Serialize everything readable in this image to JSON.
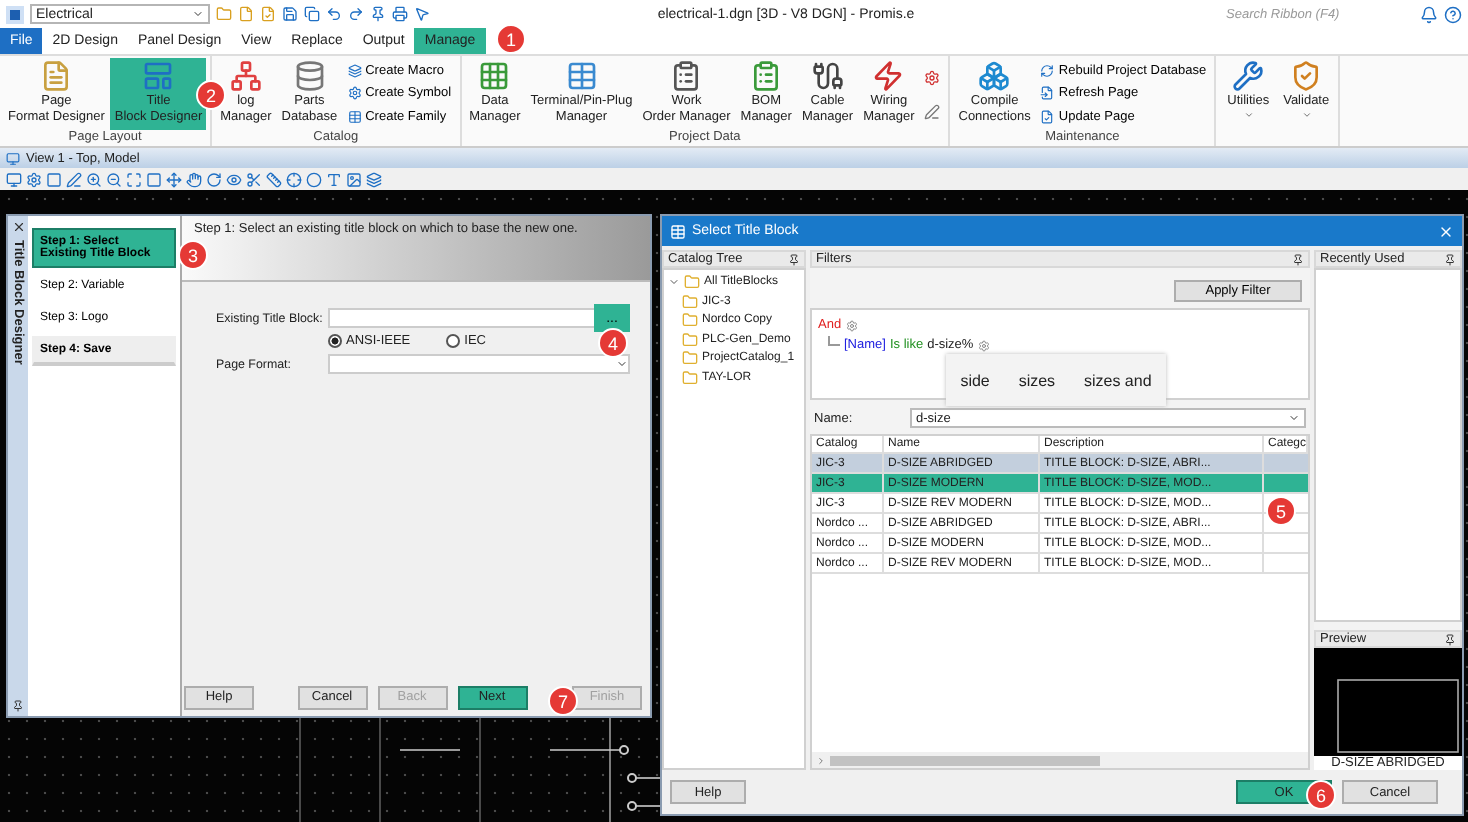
{
  "app": {
    "workspace": "Electrical",
    "document": "electrical-1.dgn [3D - V8 DGN] - Promis.e",
    "search_placeholder": "Search Ribbon (F4)"
  },
  "ribbon_tabs": [
    {
      "label": "File",
      "kind": "file",
      "selected": false
    },
    {
      "label": "2D Design",
      "kind": "tab",
      "selected": false
    },
    {
      "label": "Panel Design",
      "kind": "tab",
      "selected": false
    },
    {
      "label": "View",
      "kind": "tab",
      "selected": false
    },
    {
      "label": "Replace",
      "kind": "tab",
      "selected": false
    },
    {
      "label": "Output",
      "kind": "tab",
      "selected": false
    },
    {
      "label": "Manage",
      "kind": "tab",
      "selected": true
    }
  ],
  "ribbon_groups": [
    {
      "label": "Page Layout",
      "items": [
        {
          "kind": "large",
          "lines": [
            "Page",
            "Format Designer"
          ],
          "highlighted": false
        },
        {
          "kind": "large",
          "lines": [
            "Title",
            "Block Designer"
          ],
          "highlighted": true
        }
      ]
    },
    {
      "label": "Catalog",
      "items": [
        {
          "kind": "large",
          "lines": [
            "log",
            "Manager"
          ],
          "highlighted": false
        },
        {
          "kind": "large",
          "lines": [
            "Parts",
            "Database"
          ],
          "highlighted": false
        },
        {
          "kind": "small",
          "labels": [
            "Create Macro",
            "Create Symbol",
            "Create Family"
          ]
        }
      ]
    },
    {
      "label": "Project Data",
      "items": [
        {
          "kind": "large",
          "lines": [
            "Data",
            "Manager"
          ],
          "highlighted": false
        },
        {
          "kind": "large",
          "lines": [
            "Terminal/Pin-Plug",
            "Manager"
          ],
          "highlighted": false
        },
        {
          "kind": "large",
          "lines": [
            "Work",
            "Order Manager"
          ],
          "highlighted": false
        },
        {
          "kind": "large",
          "lines": [
            "BOM",
            "Manager"
          ],
          "highlighted": false
        },
        {
          "kind": "large",
          "lines": [
            "Cable",
            "Manager"
          ],
          "highlighted": false
        },
        {
          "kind": "large",
          "lines": [
            "Wiring",
            "Manager"
          ],
          "highlighted": false
        },
        {
          "kind": "icons"
        }
      ]
    },
    {
      "label": "Maintenance",
      "items": [
        {
          "kind": "large",
          "lines": [
            "Compile",
            "Connections"
          ],
          "highlighted": false
        },
        {
          "kind": "small",
          "labels": [
            "Rebuild Project Database",
            "Refresh Page",
            "Update Page"
          ]
        }
      ]
    },
    {
      "items": [
        {
          "kind": "menu",
          "lines": [
            "Utilities"
          ]
        },
        {
          "kind": "menu",
          "lines": [
            "Validate"
          ]
        }
      ]
    }
  ],
  "view": {
    "title": "View 1 - Top, Model"
  },
  "designer": {
    "side_title": "Title Block Designer",
    "steps": [
      {
        "label": "Step 1: Select Existing Title Block",
        "selected": true,
        "bold": true
      },
      {
        "label": "Step 2: Variable",
        "selected": false,
        "bold": false
      },
      {
        "label": "Step 3: Logo",
        "selected": false,
        "bold": false
      },
      {
        "label": "Step 4: Save",
        "selected": false,
        "bold": true
      }
    ],
    "instruction": "Step 1: Select an existing title block on which to base the new one.",
    "title_block_label": "Existing Title Block:",
    "browse_label": "...",
    "standards": [
      {
        "label": "ANSI-IEEE",
        "selected": true
      },
      {
        "label": "IEC",
        "selected": false
      }
    ],
    "page_format_label": "Page Format:",
    "buttons": [
      {
        "label": "Help",
        "disabled": false,
        "highlighted": false
      },
      {
        "label": "Cancel",
        "disabled": false,
        "highlighted": false
      },
      {
        "label": "Back",
        "disabled": true,
        "highlighted": false
      },
      {
        "label": "Next",
        "disabled": false,
        "highlighted": true
      },
      {
        "label": "Finish",
        "disabled": true,
        "highlighted": false
      }
    ]
  },
  "select_dialog": {
    "title": "Select Title Block",
    "catalog_tree": {
      "title": "Catalog Tree",
      "items": [
        {
          "label": "All TitleBlocks",
          "expanded": true,
          "children": [
            {
              "label": "JIC-3"
            },
            {
              "label": "Nordco Copy"
            },
            {
              "label": "PLC-Gen_Demo"
            },
            {
              "label": "ProjectCatalog_1"
            },
            {
              "label": "TAY-LOR"
            }
          ]
        }
      ]
    },
    "filters": {
      "title": "Filters",
      "apply_label": "Apply Filter",
      "operator": "And",
      "field": "[Name]",
      "condition": "Is like",
      "value": "d-size%",
      "suggestions": [
        "side",
        "sizes",
        "sizes and"
      ]
    },
    "name_filter": {
      "label": "Name:",
      "value": "d-size"
    },
    "table": {
      "columns": [
        "Catalog",
        "Name",
        "Description",
        "Categc"
      ],
      "rows": [
        {
          "cells": [
            "JIC-3",
            "D-SIZE ABRIDGED",
            "TITLE BLOCK: D-SIZE, ABRI..."
          ],
          "selected": false,
          "hovered": true
        },
        {
          "cells": [
            "JIC-3",
            "D-SIZE MODERN",
            "TITLE BLOCK: D-SIZE, MOD..."
          ],
          "selected": true,
          "hovered": false
        },
        {
          "cells": [
            "JIC-3",
            "D-SIZE REV MODERN",
            "TITLE BLOCK: D-SIZE, MOD..."
          ],
          "selected": false,
          "hovered": false
        },
        {
          "cells": [
            "Nordco ...",
            "D-SIZE ABRIDGED",
            "TITLE BLOCK: D-SIZE, ABRI..."
          ],
          "selected": false,
          "hovered": false
        },
        {
          "cells": [
            "Nordco ...",
            "D-SIZE MODERN",
            "TITLE BLOCK: D-SIZE, MOD..."
          ],
          "selected": false,
          "hovered": false
        },
        {
          "cells": [
            "Nordco ...",
            "D-SIZE REV MODERN",
            "TITLE BLOCK: D-SIZE, MOD..."
          ],
          "selected": false,
          "hovered": false
        }
      ]
    },
    "recently_used_title": "Recently Used",
    "preview": {
      "title": "Preview",
      "caption": "D-SIZE ABRIDGED"
    },
    "buttons": [
      {
        "label": "Help",
        "highlighted": false
      },
      {
        "label": "OK",
        "highlighted": true
      },
      {
        "label": "Cancel",
        "highlighted": false
      }
    ]
  },
  "callouts": [
    "1",
    "2",
    "3",
    "4",
    "5",
    "6",
    "7"
  ]
}
